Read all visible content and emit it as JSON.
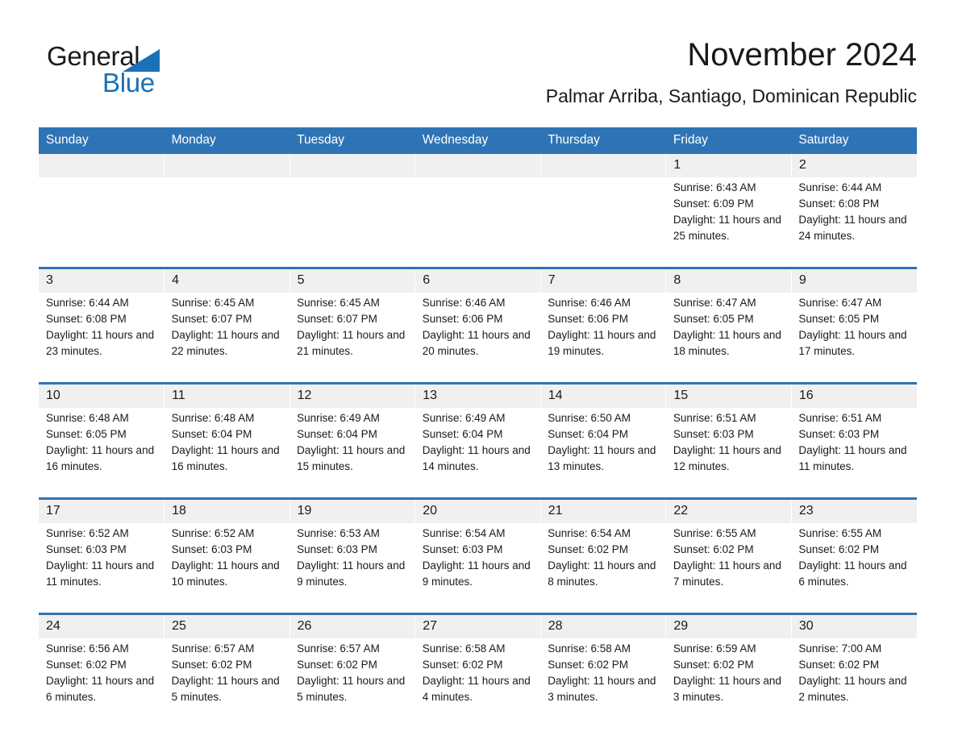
{
  "brand": {
    "name_part1": "General",
    "name_part2": "Blue",
    "accent_color": "#1a71b8"
  },
  "header": {
    "title": "November 2024",
    "subtitle": "Palmar Arriba, Santiago, Dominican Republic",
    "header_bg_color": "#2e74b5",
    "date_band_color": "#f0f0f0"
  },
  "weekday_headers": [
    "Sunday",
    "Monday",
    "Tuesday",
    "Wednesday",
    "Thursday",
    "Friday",
    "Saturday"
  ],
  "weeks": [
    {
      "dates": [
        "",
        "",
        "",
        "",
        "",
        "1",
        "2"
      ],
      "details": [
        "",
        "",
        "",
        "",
        "",
        "Sunrise: 6:43 AM\nSunset: 6:09 PM\nDaylight: 11 hours and 25 minutes.",
        "Sunrise: 6:44 AM\nSunset: 6:08 PM\nDaylight: 11 hours and 24 minutes."
      ]
    },
    {
      "dates": [
        "3",
        "4",
        "5",
        "6",
        "7",
        "8",
        "9"
      ],
      "details": [
        "Sunrise: 6:44 AM\nSunset: 6:08 PM\nDaylight: 11 hours and 23 minutes.",
        "Sunrise: 6:45 AM\nSunset: 6:07 PM\nDaylight: 11 hours and 22 minutes.",
        "Sunrise: 6:45 AM\nSunset: 6:07 PM\nDaylight: 11 hours and 21 minutes.",
        "Sunrise: 6:46 AM\nSunset: 6:06 PM\nDaylight: 11 hours and 20 minutes.",
        "Sunrise: 6:46 AM\nSunset: 6:06 PM\nDaylight: 11 hours and 19 minutes.",
        "Sunrise: 6:47 AM\nSunset: 6:05 PM\nDaylight: 11 hours and 18 minutes.",
        "Sunrise: 6:47 AM\nSunset: 6:05 PM\nDaylight: 11 hours and 17 minutes."
      ]
    },
    {
      "dates": [
        "10",
        "11",
        "12",
        "13",
        "14",
        "15",
        "16"
      ],
      "details": [
        "Sunrise: 6:48 AM\nSunset: 6:05 PM\nDaylight: 11 hours and 16 minutes.",
        "Sunrise: 6:48 AM\nSunset: 6:04 PM\nDaylight: 11 hours and 16 minutes.",
        "Sunrise: 6:49 AM\nSunset: 6:04 PM\nDaylight: 11 hours and 15 minutes.",
        "Sunrise: 6:49 AM\nSunset: 6:04 PM\nDaylight: 11 hours and 14 minutes.",
        "Sunrise: 6:50 AM\nSunset: 6:04 PM\nDaylight: 11 hours and 13 minutes.",
        "Sunrise: 6:51 AM\nSunset: 6:03 PM\nDaylight: 11 hours and 12 minutes.",
        "Sunrise: 6:51 AM\nSunset: 6:03 PM\nDaylight: 11 hours and 11 minutes."
      ]
    },
    {
      "dates": [
        "17",
        "18",
        "19",
        "20",
        "21",
        "22",
        "23"
      ],
      "details": [
        "Sunrise: 6:52 AM\nSunset: 6:03 PM\nDaylight: 11 hours and 11 minutes.",
        "Sunrise: 6:52 AM\nSunset: 6:03 PM\nDaylight: 11 hours and 10 minutes.",
        "Sunrise: 6:53 AM\nSunset: 6:03 PM\nDaylight: 11 hours and 9 minutes.",
        "Sunrise: 6:54 AM\nSunset: 6:03 PM\nDaylight: 11 hours and 9 minutes.",
        "Sunrise: 6:54 AM\nSunset: 6:02 PM\nDaylight: 11 hours and 8 minutes.",
        "Sunrise: 6:55 AM\nSunset: 6:02 PM\nDaylight: 11 hours and 7 minutes.",
        "Sunrise: 6:55 AM\nSunset: 6:02 PM\nDaylight: 11 hours and 6 minutes."
      ]
    },
    {
      "dates": [
        "24",
        "25",
        "26",
        "27",
        "28",
        "29",
        "30"
      ],
      "details": [
        "Sunrise: 6:56 AM\nSunset: 6:02 PM\nDaylight: 11 hours and 6 minutes.",
        "Sunrise: 6:57 AM\nSunset: 6:02 PM\nDaylight: 11 hours and 5 minutes.",
        "Sunrise: 6:57 AM\nSunset: 6:02 PM\nDaylight: 11 hours and 5 minutes.",
        "Sunrise: 6:58 AM\nSunset: 6:02 PM\nDaylight: 11 hours and 4 minutes.",
        "Sunrise: 6:58 AM\nSunset: 6:02 PM\nDaylight: 11 hours and 3 minutes.",
        "Sunrise: 6:59 AM\nSunset: 6:02 PM\nDaylight: 11 hours and 3 minutes.",
        "Sunrise: 7:00 AM\nSunset: 6:02 PM\nDaylight: 11 hours and 2 minutes."
      ]
    }
  ]
}
